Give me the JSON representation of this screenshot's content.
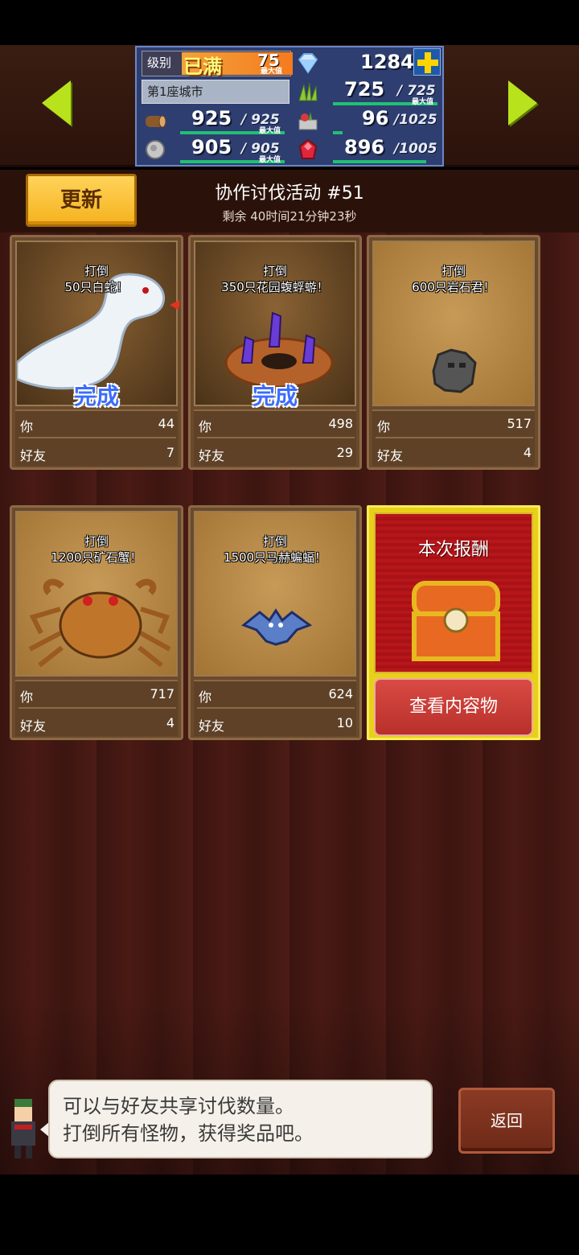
{
  "header": {
    "level_label": "级别",
    "level_status": "已满",
    "level_value": "75",
    "level_max_label": "最大值",
    "city_name": "第1座城市",
    "gems": "1284",
    "resources": [
      {
        "icon": "wood-log-icon",
        "value": "925",
        "max": "/ 925",
        "max_label": "最大值",
        "progress": 1.0
      },
      {
        "icon": "stone-ore-icon",
        "value": "905",
        "max": "/ 905",
        "max_label": "最大值",
        "progress": 1.0
      },
      {
        "icon": "grass-crop-icon",
        "value": "725",
        "max": "/ 725",
        "max_label": "最大值",
        "progress": 1.0
      },
      {
        "icon": "vegetable-basket-icon",
        "value": "96",
        "max": "/1025",
        "max_label": "",
        "progress": 0.094
      },
      {
        "icon": "red-gem-icon",
        "value": "896",
        "max": "/1005",
        "max_label": "",
        "progress": 0.89
      }
    ]
  },
  "event": {
    "refresh_label": "更新",
    "title": "协作讨伐活动 #51",
    "remaining": "剩余 40时间21分钟23秒"
  },
  "labels": {
    "you": "你",
    "friends": "好友",
    "done": "完成"
  },
  "cards": [
    {
      "mission_1": "打倒",
      "mission_2": "50只白蛇！",
      "you": "44",
      "friends": "7",
      "completed": true
    },
    {
      "mission_1": "打倒",
      "mission_2": "350只花园蝮蜉蝣！",
      "you": "498",
      "friends": "29",
      "completed": true
    },
    {
      "mission_1": "打倒",
      "mission_2": "600只岩石君！",
      "you": "517",
      "friends": "4",
      "completed": false
    },
    {
      "mission_1": "打倒",
      "mission_2": "1200只矿石蟹！",
      "you": "717",
      "friends": "4",
      "completed": false
    },
    {
      "mission_1": "打倒",
      "mission_2": "1500只马赫蝙蝠！",
      "you": "624",
      "friends": "10",
      "completed": false
    }
  ],
  "reward": {
    "title": "本次报酬",
    "button": "查看内容物"
  },
  "dialog": {
    "line1": "可以与好友共享讨伐数量。",
    "line2": "打倒所有怪物，获得奖品吧。"
  },
  "back_label": "返回"
}
